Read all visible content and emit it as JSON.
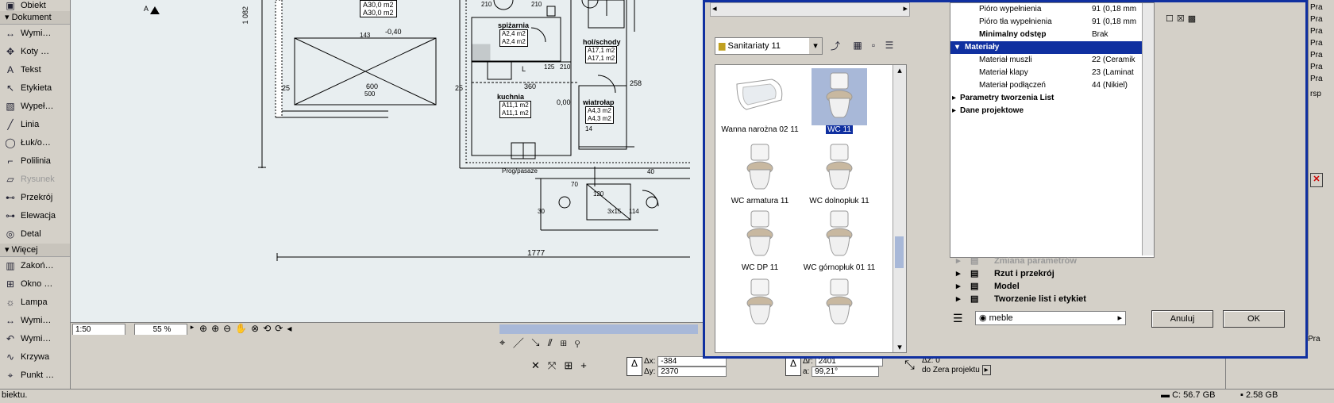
{
  "toolbox": {
    "top_item": "Obiekt",
    "section_doc": "Dokument",
    "doc_items": [
      {
        "label": "Wymi…",
        "icon": "dimension-icon",
        "disabled": false
      },
      {
        "label": "Koty …",
        "icon": "level-dimension-icon",
        "disabled": false
      },
      {
        "label": "Tekst",
        "icon": "text-icon",
        "disabled": false
      },
      {
        "label": "Etykieta",
        "icon": "label-icon",
        "disabled": false
      },
      {
        "label": "Wypeł…",
        "icon": "fill-icon",
        "disabled": false
      },
      {
        "label": "Linia",
        "icon": "line-icon",
        "disabled": false
      },
      {
        "label": "Łuk/o…",
        "icon": "arc-icon",
        "disabled": false
      },
      {
        "label": "Polilinia",
        "icon": "polyline-icon",
        "disabled": false
      },
      {
        "label": "Rysunek",
        "icon": "drawing-icon",
        "disabled": true
      },
      {
        "label": "Przekrój",
        "icon": "section-icon",
        "disabled": false
      },
      {
        "label": "Elewacja",
        "icon": "elevation-icon",
        "disabled": false
      },
      {
        "label": "Detal",
        "icon": "detail-icon",
        "disabled": false
      }
    ],
    "section_more": "Więcej",
    "more_items": [
      {
        "label": "Zakoń…",
        "icon": "roof-end-icon"
      },
      {
        "label": "Okno …",
        "icon": "window-icon"
      },
      {
        "label": "Lampa",
        "icon": "lamp-icon"
      },
      {
        "label": "Wymi…",
        "icon": "dimension-icon"
      },
      {
        "label": "Wymi…",
        "icon": "radial-dimension-icon"
      },
      {
        "label": "Krzywa",
        "icon": "curve-icon"
      },
      {
        "label": "Punkt …",
        "icon": "point-icon"
      }
    ]
  },
  "drawing": {
    "labels": {
      "spizarnia": "spiżarnia",
      "spiz_a1": "A2,4 m2",
      "spiz_a2": "A2,4 m2",
      "hol": "hol/schody",
      "hol_a1": "A17,1 m2",
      "hol_a2": "A17,1 m2",
      "kuchnia": "kuchnia",
      "kuch_a1": "A11,1 m2",
      "kuch_a2": "A11,1 m2",
      "wiatrolap": "wiatrołap",
      "wiat_a1": "A4,3 m2",
      "wiat_a2": "A4,3 m2",
      "top_a1": "A30,0 m2",
      "top_a2": "A30,0 m2",
      "d210a": "210",
      "d210b": "210",
      "d_040": "-0,40",
      "d600": "600",
      "d25a": "25",
      "d25b": "25",
      "d360": "360",
      "d125": "125",
      "d210c": "210",
      "d258": "258",
      "d000": "0,00",
      "d1777": "1777",
      "d1082": "1 082",
      "d500": "500",
      "d143": "143",
      "d70": "70",
      "d120": "120",
      "d40": "40",
      "d3x15": "3x15",
      "d30": "30",
      "d14": "14",
      "d114": "114",
      "L": "L",
      "stairs": "Prog/pasaze",
      "marker": "A"
    },
    "scale": "1:50",
    "zoom": "55 %"
  },
  "dialog": {
    "folder": "Sanitariaty 11",
    "objects": [
      {
        "name": "Wanna narożna 02 11",
        "selected": false,
        "icon": "corner-bathtub-icon"
      },
      {
        "name": "WC 11",
        "selected": true,
        "icon": "toilet-icon"
      },
      {
        "name": "WC armatura 11",
        "selected": false,
        "icon": "toilet-icon"
      },
      {
        "name": "WC dolnopłuk 11",
        "selected": false,
        "icon": "toilet-icon"
      },
      {
        "name": "WC DP 11",
        "selected": false,
        "icon": "toilet-icon"
      },
      {
        "name": "WC górnopłuk 01 11",
        "selected": false,
        "icon": "toilet-icon"
      },
      {
        "name": "",
        "selected": false,
        "icon": "toilet-icon"
      },
      {
        "name": "",
        "selected": false,
        "icon": "toilet-icon"
      }
    ],
    "params": [
      {
        "label": "Pióro wypełnienia",
        "value": "91 (0,18 mm",
        "kind": "row"
      },
      {
        "label": "Pióro tła wypełnienia",
        "value": "91 (0,18 mm",
        "kind": "row"
      },
      {
        "label": "Minimalny odstęp",
        "value": "Brak",
        "kind": "bold"
      },
      {
        "label": "Materiały",
        "value": "",
        "kind": "cat"
      },
      {
        "label": "Materiał muszli",
        "value": "22 (Ceramik",
        "kind": "row"
      },
      {
        "label": "Materiał klapy",
        "value": "23 (Laminat",
        "kind": "row"
      },
      {
        "label": "Materiał podłączeń",
        "value": "44 (Nikiel)",
        "kind": "row"
      },
      {
        "label": "Parametry tworzenia List",
        "value": "",
        "kind": "sub"
      },
      {
        "label": "Dane projektowe",
        "value": "",
        "kind": "sub"
      }
    ],
    "sections": [
      "Zmiana parametrów",
      "Rzut i przekrój",
      "Model",
      "Tworzenie list i etykiet"
    ],
    "layer": "meble",
    "cancel": "Anuluj",
    "ok": "OK"
  },
  "coords": {
    "dx_label": "Δx:",
    "dx": "-384",
    "dy_label": "Δy:",
    "dy": "2370",
    "dr_label": "Δr:",
    "dr": "2401",
    "a_label": "a:",
    "a": "99,21°",
    "dz_label": "Δz:",
    "dz": "0",
    "ref": "do Zera projektu"
  },
  "right_edge": {
    "texts": [
      "Pra",
      "Pra",
      "Pra",
      "Pra",
      "Pra",
      "Pra",
      "Pra",
      "rsp",
      "Pra"
    ]
  },
  "status": {
    "message": "biektu.",
    "disk": "C: 56.7 GB",
    "ram": "2.58 GB"
  }
}
